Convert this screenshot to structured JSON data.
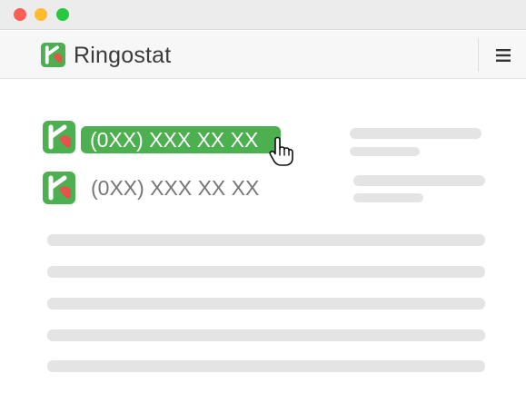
{
  "window": {
    "controls": [
      "close",
      "minimize",
      "maximize"
    ]
  },
  "header": {
    "brand": "Ringostat",
    "logo_icon": "ringostat-logo-icon",
    "menu_icon": "hamburger-menu-icon"
  },
  "numbers": [
    {
      "phone": "(0XX) XXX XX XX",
      "state": "highlighted"
    },
    {
      "phone": "(0XX) XXX XX XX",
      "state": "normal"
    }
  ],
  "cursor_icon": "hand-pointer-icon",
  "colors": {
    "brand_green": "#4caf50",
    "brand_red": "#e5534b",
    "placeholder": "#e4e4e4"
  }
}
